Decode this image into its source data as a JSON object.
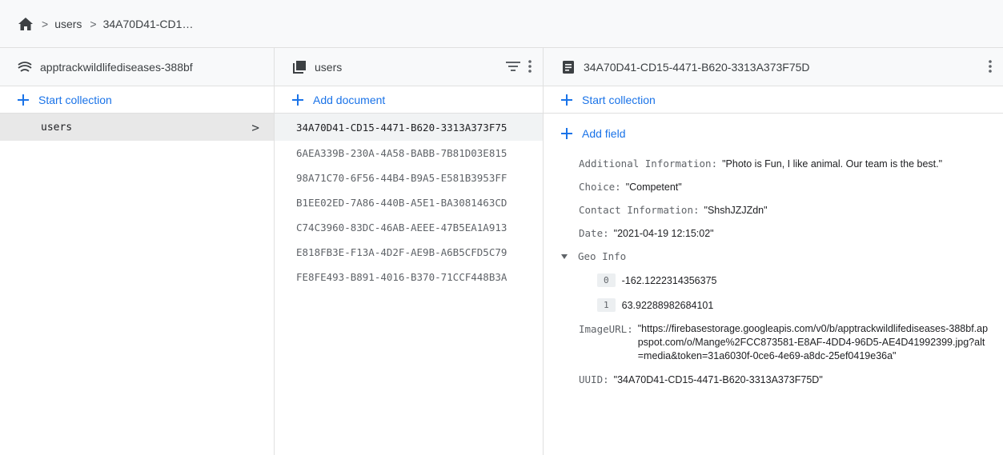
{
  "breadcrumb": {
    "home_icon": "home-icon",
    "items": [
      "users",
      "34A70D41-CD1…"
    ]
  },
  "root_panel": {
    "project_name": "apptrackwildlifediseases-388bf",
    "start_collection_label": "Start collection",
    "collections": [
      {
        "name": "users"
      }
    ]
  },
  "collection_panel": {
    "title": "users",
    "add_document_label": "Add document",
    "documents": [
      "34A70D41-CD15-4471-B620-3313A373F75",
      "6AEA339B-230A-4A58-BABB-7B81D03E815",
      "98A71C70-6F56-44B4-B9A5-E581B3953FF",
      "B1EE02ED-7A86-440B-A5E1-BA3081463CD",
      "C74C3960-83DC-46AB-AEEE-47B5EA1A913",
      "E818FB3E-F13A-4D2F-AE9B-A6B5CFD5C79",
      "FE8FE493-B891-4016-B370-71CCF448B3A"
    ]
  },
  "document_panel": {
    "title": "34A70D41-CD15-4471-B620-3313A373F75D",
    "start_collection_label": "Start collection",
    "add_field_label": "Add field",
    "fields": {
      "additional_information": {
        "key": "Additional Information:",
        "value": "\"Photo is Fun, I like animal. Our team is the best.\""
      },
      "choice": {
        "key": "Choice:",
        "value": "\"Competent\""
      },
      "contact_information": {
        "key": "Contact Information:",
        "value": "\"ShshJZJZdn\""
      },
      "date": {
        "key": "Date:",
        "value": "\"2021-04-19 12:15:02\""
      },
      "geo_info": {
        "key": "Geo Info",
        "items": [
          {
            "index": "0",
            "value": "-162.1222314356375"
          },
          {
            "index": "1",
            "value": "63.92288982684101"
          }
        ]
      },
      "image_url": {
        "key": "ImageURL:",
        "value": "\"https://firebasestorage.googleapis.com/v0/b/apptrackwildlifediseases-388bf.appspot.com/o/Mange%2FCC873581-E8AF-4DD4-96D5-AE4D41992399.jpg?alt=media&token=31a6030f-0ce6-4e69-a8dc-25ef0419e36a\""
      },
      "uuid": {
        "key": "UUID:",
        "value": "\"34A70D41-CD15-4471-B620-3313A373F75D\""
      }
    }
  },
  "colors": {
    "accent": "#1a73e8",
    "header_bg": "#f8f9fa",
    "selected_bg": "#e8e8e8",
    "border": "#e0e0e0"
  }
}
